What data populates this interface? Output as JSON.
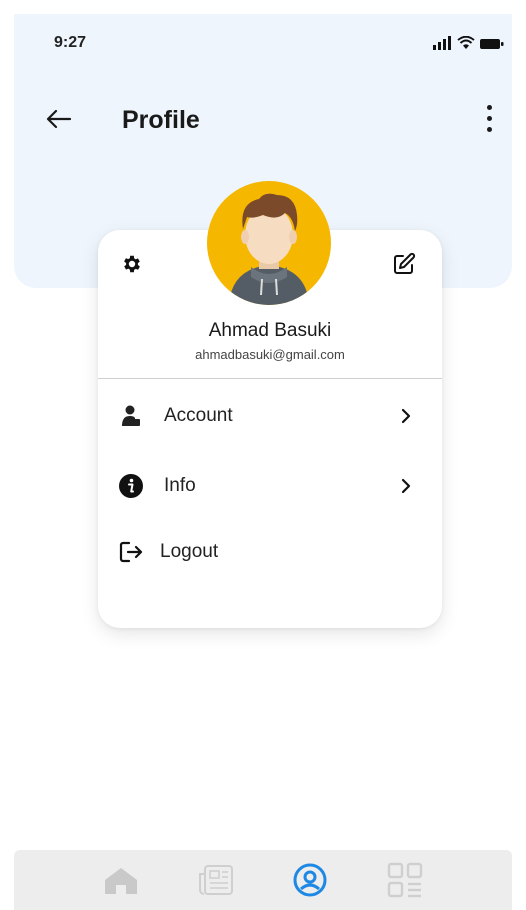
{
  "status_bar": {
    "time": "9:27"
  },
  "header": {
    "title": "Profile"
  },
  "profile": {
    "name": "Ahmad Basuki",
    "email": "ahmadbasuki@gmail.com"
  },
  "menu": {
    "items": [
      {
        "label": "Account",
        "icon": "user-icon"
      },
      {
        "label": "Info",
        "icon": "info-icon"
      },
      {
        "label": "Logout",
        "icon": "logout-icon"
      }
    ]
  },
  "bottom_nav": {
    "items": [
      {
        "icon": "home-icon",
        "active": false
      },
      {
        "icon": "news-icon",
        "active": false
      },
      {
        "icon": "profile-icon",
        "active": true
      },
      {
        "icon": "grid-icon",
        "active": false
      }
    ]
  },
  "colors": {
    "header_background": "#eef5fc",
    "avatar_background": "#f5b700",
    "nav_active": "#1e88e5",
    "nav_inactive": "#cfcfcf"
  }
}
